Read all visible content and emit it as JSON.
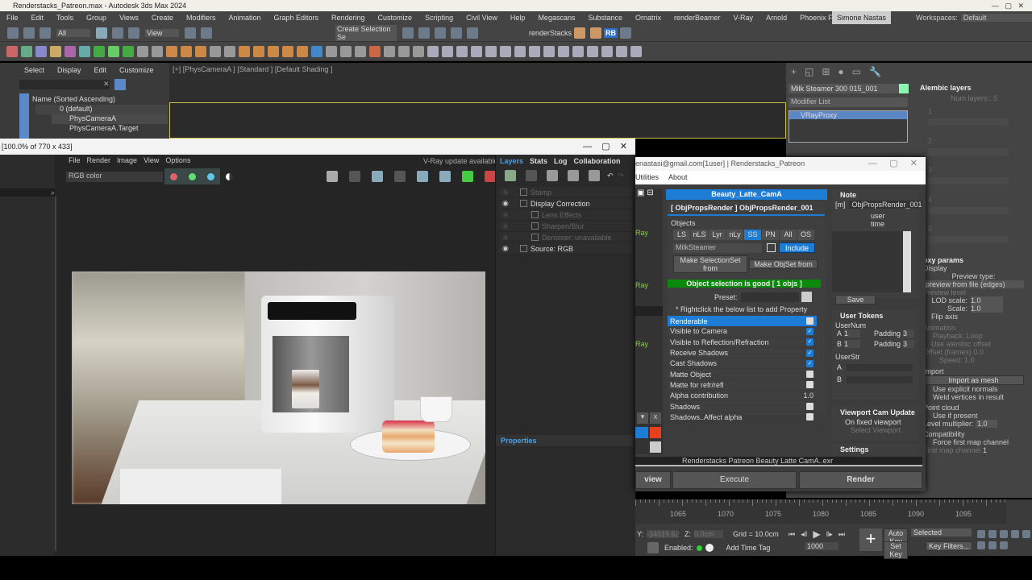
{
  "app": {
    "title": "Renderstacks_Patreon.max - Autodesk 3ds Max 2024",
    "menu": [
      "File",
      "Edit",
      "Tools",
      "Group",
      "Views",
      "Create",
      "Modifiers",
      "Animation",
      "Graph Editors",
      "Rendering",
      "Customize",
      "Scripting",
      "Civil View",
      "Help",
      "Megascans",
      "Substance",
      "Ornatrix",
      "renderBeamer",
      "V-Ray",
      "Arnold",
      "Phoenix FD"
    ],
    "user": "Simone Nastas",
    "workspaces_label": "Workspaces:",
    "workspace": "Default",
    "toolbar": {
      "filter": "All",
      "view": "View",
      "selection_set": "Create Selection Se",
      "renderstacks_label": "renderStacks",
      "rb": "RB"
    }
  },
  "explorer": {
    "menu": [
      "Select",
      "Display",
      "Edit",
      "Customize"
    ],
    "header": "Name (Sorted Ascending)",
    "items": [
      "0 (default)",
      "PhysCameraA",
      "PhysCameraA.Target"
    ]
  },
  "viewport": {
    "label": "[+] [PhysCameraA ] [Standard ] [Default Shading ]"
  },
  "command_panel": {
    "object_name": "Milk Steamer 300 015_001",
    "object_color": "#8ef5b0",
    "modifier_list": "Modifier List",
    "stack_item": "VRayProxy",
    "alembic": {
      "title": "Alembic layers",
      "num_layers_label": "Num layers::",
      "num_layers": "5",
      "layers": [
        "1",
        "2",
        "3",
        "4",
        "5"
      ]
    },
    "proxy": {
      "title": "oxy params",
      "display": "Display",
      "preview_type_label": "Preview type:",
      "preview_type": "preview from file (edges)",
      "preview_level": "Preview level",
      "lod_label": "LOD scale:",
      "lod": "1.0",
      "scale_label": "Scale:",
      "scale": "1.0",
      "flip": "Flip axis",
      "animation": "Animation",
      "playback_label": "Playback:",
      "playback": "Loop",
      "use_offset": "Use alembic offset",
      "offset_label": "Offset (frames)",
      "offset": "0.0",
      "speed_label": "Speed:",
      "speed": "1.0",
      "import": "Import",
      "import_mesh": "Import as mesh",
      "explicit_normals": "Use explicit normals",
      "weld": "Weld vertices in result",
      "point_cloud": "Point cloud",
      "use_if_present": "Use if present",
      "level_mult_label": "Level multiplier:",
      "level_mult": "1.0",
      "compat": "Compatibility",
      "force_first": "Force first map channel",
      "first_map_label": "First map channel",
      "first_map": "1"
    }
  },
  "vfb": {
    "title": "[100.0% of 770 x 433]",
    "menu": [
      "File",
      "Render",
      "Image",
      "View",
      "Options"
    ],
    "update": "V-Ray update available!",
    "channel": "RGB color",
    "tabs": [
      "Layers",
      "Stats",
      "Log",
      "Collaboration"
    ],
    "layers": [
      {
        "name": "Stamp",
        "enabled": false
      },
      {
        "name": "Display Correction",
        "enabled": true
      },
      {
        "name": "Lens Effects",
        "enabled": false
      },
      {
        "name": "Sharpen/Blur",
        "enabled": false
      },
      {
        "name": "Denoiser: unavailable",
        "enabled": false
      },
      {
        "name": "Source: RGB",
        "enabled": true
      }
    ],
    "properties": "Properties"
  },
  "renderstacks": {
    "title": "enastasi@gmail.com[1user] | Renderstacks_Patreon",
    "menu": [
      "Utilities",
      "About"
    ],
    "stack_name": "Beauty_Latte_CamA",
    "rollout": "[ ObjPropsRender ] ObjPropsRender_001",
    "objects_label": "Objects",
    "filters": [
      "LS",
      "nLS",
      "Lyr",
      "nLy",
      "SS",
      "PN",
      "All",
      "OS"
    ],
    "active_filter": "SS",
    "selection": "MilkSteamer",
    "include": "Include",
    "make_selset": "Make SelectionSet from",
    "make_objset": "Make ObjSet from",
    "status": "Object selection is good [ 1 objs ]",
    "preset_label": "Preset:",
    "hint": "* Rightclick the below list to add Property",
    "properties": [
      {
        "name": "Renderable",
        "value": false,
        "selected": true
      },
      {
        "name": "Visible to Camera",
        "value": true
      },
      {
        "name": "Visible to Reflection/Refraction",
        "value": true
      },
      {
        "name": "Receive Shadows",
        "value": true
      },
      {
        "name": "Cast Shadows",
        "value": true
      },
      {
        "name": "Matte Object",
        "value": false
      },
      {
        "name": "Matte for refr/refl",
        "value": false
      },
      {
        "name": "Alpha contribution",
        "value": "1.0"
      },
      {
        "name": "Shadows",
        "value": false
      },
      {
        "name": "Shadows..Affect alpha",
        "value": false
      }
    ],
    "side_labels": [
      "Ray",
      "Ray",
      "Ray"
    ],
    "note": {
      "title": "Note",
      "tag": "[m]",
      "name": "ObjPropsRender_001",
      "user": "user",
      "time": "time",
      "save": "Save"
    },
    "tokens": {
      "title": "User Tokens",
      "usernum": "UserNum",
      "a": "A",
      "b": "B",
      "a_val": "1",
      "b_val": "1",
      "padding": "Padding",
      "pad_a": "3",
      "pad_b": "3",
      "userstr": "UserStr"
    },
    "viewport_cam": {
      "title": "Viewport Cam Update",
      "fixed": "On fixed viewport",
      "select": "Select Viewport"
    },
    "settings": "Settings",
    "output": "Renderstacks  Patreon  Beauty  Latte  CamA..exr",
    "preview": "view",
    "execute": "Execute",
    "render": "Render"
  },
  "timeline": {
    "ticks": [
      "1065",
      "1070",
      "1075",
      "1080",
      "1085",
      "1090",
      "1095"
    ],
    "y_label": "Y:",
    "y": "-34019.62",
    "z_label": "Z:",
    "z": "0.0cm",
    "grid": "Grid = 10.0cm",
    "enabled": "Enabled:",
    "add_time_tag": "Add Time Tag",
    "frame": "1000",
    "auto_key": "Auto Key",
    "set_key": "Set Key",
    "key_mode": "Selected",
    "key_filters": "Key Filters..."
  }
}
